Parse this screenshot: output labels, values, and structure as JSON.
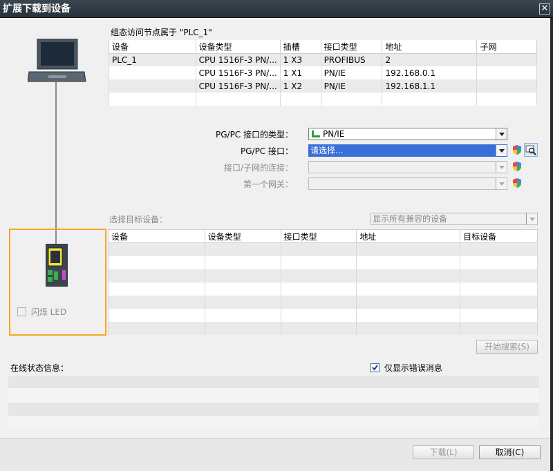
{
  "window": {
    "title": "扩展下载到设备",
    "close_glyph": "✕"
  },
  "config": {
    "heading": "组态访问节点属于 \"PLC_1\"",
    "columns": [
      "设备",
      "设备类型",
      "插槽",
      "接口类型",
      "地址",
      "子网"
    ],
    "rows": [
      [
        "PLC_1",
        "CPU 1516F-3 PN/...",
        "1 X3",
        "PROFIBUS",
        "2",
        ""
      ],
      [
        "",
        "CPU 1516F-3 PN/...",
        "1 X1",
        "PN/IE",
        "192.168.0.1",
        ""
      ],
      [
        "",
        "CPU 1516F-3 PN/...",
        "1 X2",
        "PN/IE",
        "192.168.1.1",
        ""
      ]
    ]
  },
  "interface": {
    "type_label": "PG/PC 接口的类型：",
    "type_value": "PN/IE",
    "iface_label": "PG/PC 接口：",
    "iface_value": "请选择...",
    "subnet_label": "接口/子网的连接：",
    "gateway_label": "第一个网关："
  },
  "target": {
    "label": "选择目标设备：",
    "filter_value": "显示所有兼容的设备",
    "columns": [
      "设备",
      "设备类型",
      "接口类型",
      "地址",
      "目标设备"
    ]
  },
  "led": {
    "label": "闪烁 LED"
  },
  "buttons": {
    "search": "开始搜索(S)",
    "download": "下载(L)",
    "cancel": "取消(C)"
  },
  "status": {
    "label": "在线状态信息：",
    "errors_only_label": "仅显示错误消息",
    "errors_only_checked": true
  },
  "colors": {
    "selection": "#3b6fd8",
    "highlight_box": "#f5a623",
    "pn_ie_icon": "#2a9d3a"
  }
}
